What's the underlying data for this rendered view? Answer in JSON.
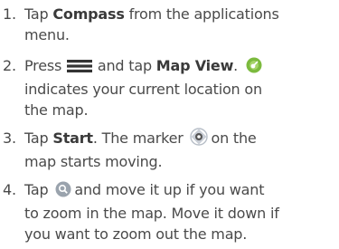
{
  "colors": {
    "text": "#4a4a4a",
    "location_marker": "#7cba3e",
    "zoom_icon": "#9aa3ad"
  },
  "steps": [
    {
      "number": "1.",
      "line1_pre": "Tap ",
      "line1_bold": "Compass",
      "line1_post": " from the applications",
      "line2": "menu."
    },
    {
      "number": "2.",
      "line1_pre": "Press ",
      "menu_icon": "menu-icon",
      "line1_mid": " and tap ",
      "line1_bold": "Map View",
      "line1_post": ".",
      "location_icon": "current-location-icon",
      "line2": "indicates your current location on",
      "line3": "the map."
    },
    {
      "number": "3.",
      "line1_pre": "Tap ",
      "line1_bold": "Start",
      "line1_mid": ". The marker",
      "marker_icon": "map-marker-icon",
      "line1_post": "on the",
      "line2": "map starts moving."
    },
    {
      "number": "4.",
      "line1_pre": "Tap",
      "zoom_icon": "zoom-icon",
      "line1_post": "and move it up if you want",
      "line2": "to zoom in the map. Move it down if",
      "line3": "you want to zoom out the map."
    }
  ]
}
